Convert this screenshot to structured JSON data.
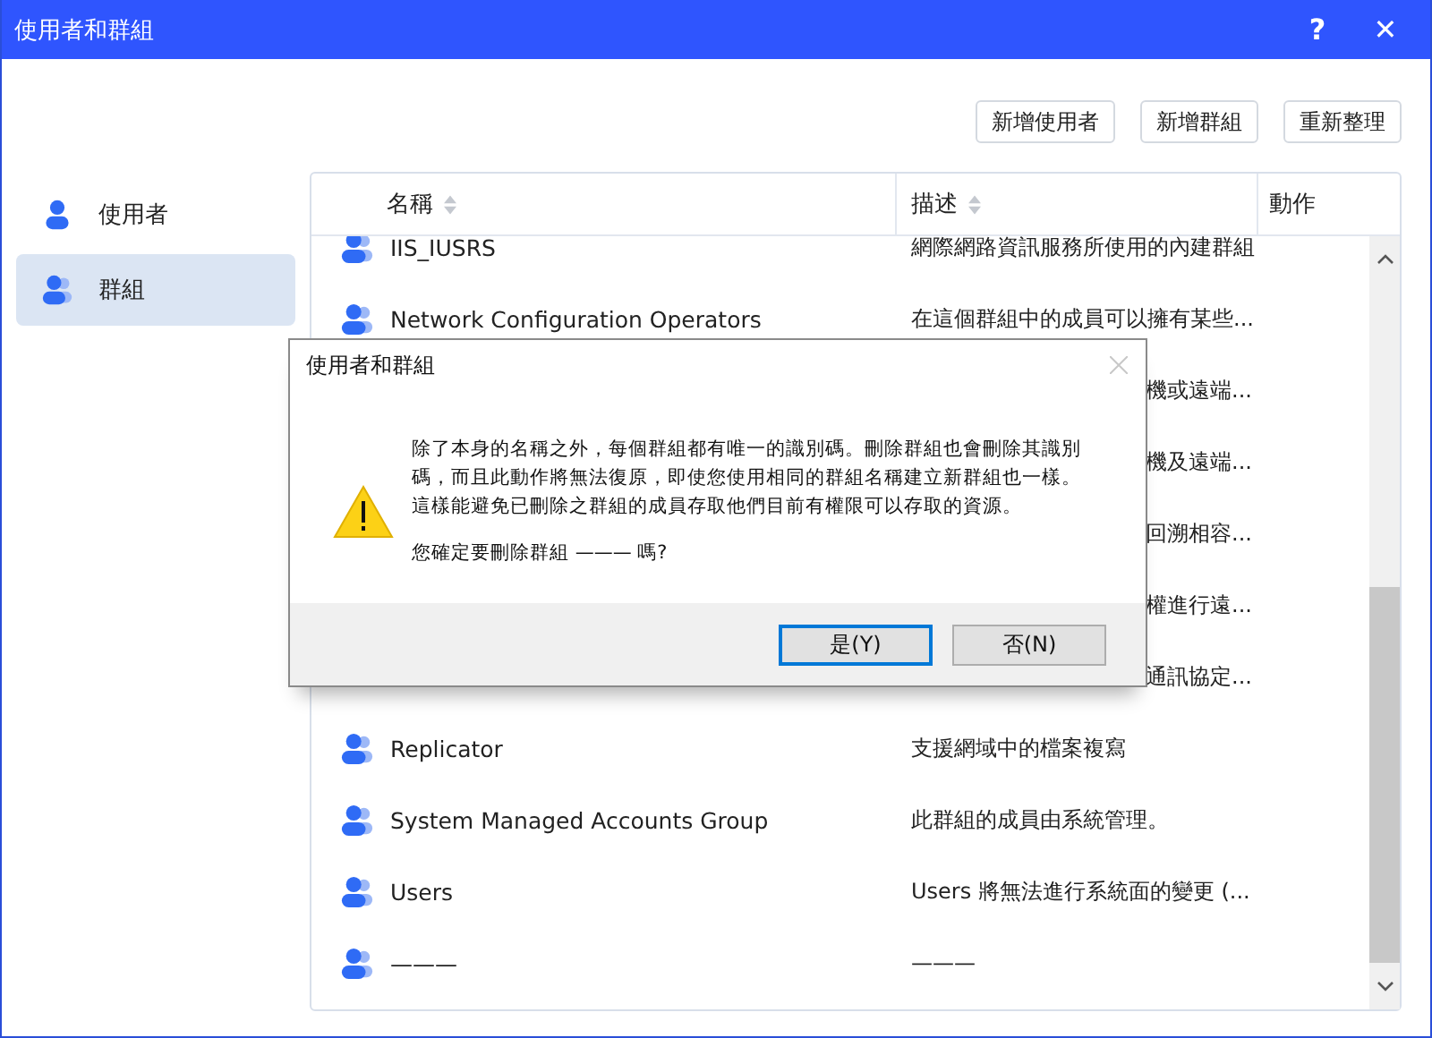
{
  "window": {
    "title": "使用者和群組",
    "help": "?",
    "close": "✕"
  },
  "toolbar": {
    "buttons": [
      "新增使用者",
      "新增群組",
      "重新整理"
    ]
  },
  "sidebar": {
    "items": [
      {
        "label": "使用者",
        "kind": "user",
        "selected": false
      },
      {
        "label": "群組",
        "kind": "group",
        "selected": true
      }
    ]
  },
  "table": {
    "columns": [
      {
        "label": "名稱",
        "sortable": true
      },
      {
        "label": "描述",
        "sortable": true
      },
      {
        "label": "動作",
        "sortable": false
      }
    ],
    "rows": [
      {
        "name": "IIS_IUSRS",
        "description": "網際網路資訊服務所使用的內建群組"
      },
      {
        "name": "Network Configuration Operators",
        "description": "在這個群組中的成員可以擁有某些..."
      },
      {
        "description": "機或遠端..."
      },
      {
        "description": "機及遠端..."
      },
      {
        "description": "回溯相容..."
      },
      {
        "description": "權進行遠..."
      },
      {
        "description": "通訊協定..."
      },
      {
        "name": "Replicator",
        "description": "支援網域中的檔案複寫"
      },
      {
        "name": "System Managed Accounts Group",
        "description": "此群組的成員由系統管理。"
      },
      {
        "name": "Users",
        "description": "Users 將無法進行系統面的變更 (..."
      },
      {
        "name": "———",
        "description": "———"
      }
    ]
  },
  "dialog": {
    "title": "使用者和群組",
    "message": [
      "除了本身的名稱之外，每個群組都有唯一的識別碼。刪除群組也會刪除其識別",
      "碼，而且此動作將無法復原，即使您使用相同的群組名稱建立新群組也一樣。",
      "這樣能避免已刪除之群組的成員存取他們目前有權限可以存取的資源。"
    ],
    "question": "您確定要刪除群組 ——— 嗎?",
    "buttons": [
      {
        "label": "是(Y)",
        "selected": true
      },
      {
        "label": "否(N)",
        "selected": false
      }
    ]
  }
}
